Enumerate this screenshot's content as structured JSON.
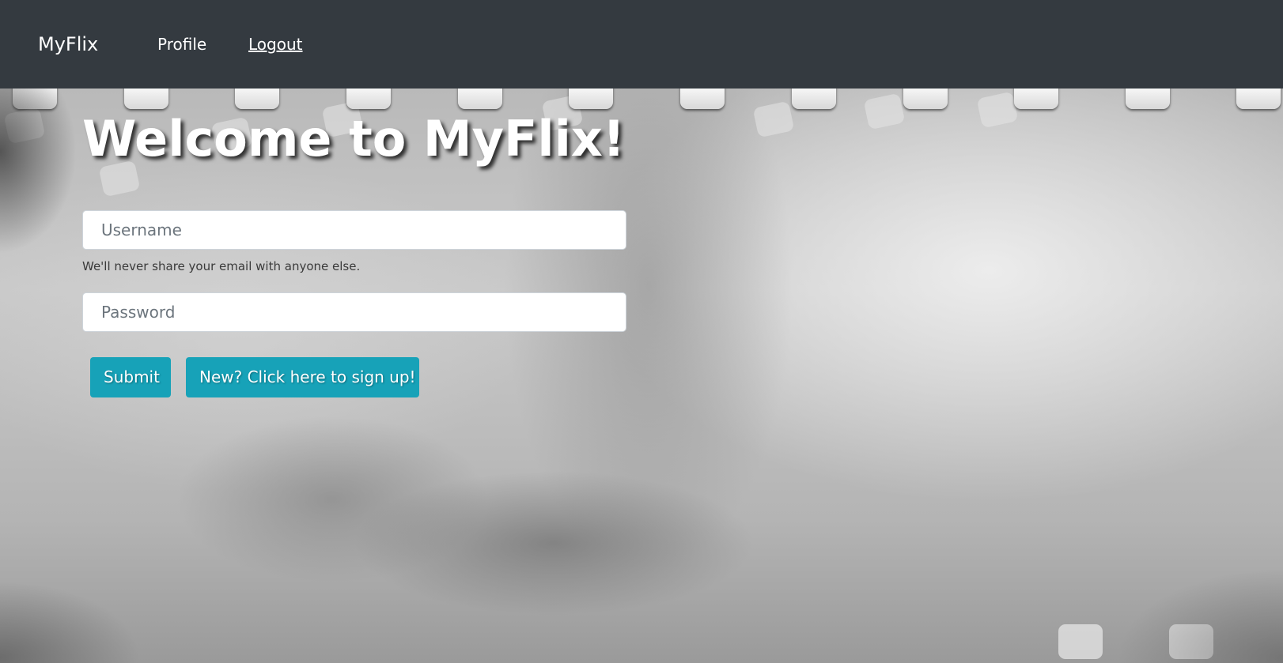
{
  "navbar": {
    "brand": "MyFlix",
    "links": [
      {
        "label": "Profile"
      },
      {
        "label": "Logout"
      }
    ]
  },
  "login": {
    "title": "Welcome to MyFlix!",
    "username": {
      "value": "",
      "placeholder": "Username"
    },
    "help_text": "We'll never share your email with anyone else.",
    "password": {
      "value": "",
      "placeholder": "Password"
    },
    "submit_label": "Submit",
    "signup_label": "New? Click here to sign up!"
  },
  "colors": {
    "navbar_bg": "#343a40",
    "button_bg": "#17a2b8",
    "text_on_dark": "#ffffff"
  }
}
